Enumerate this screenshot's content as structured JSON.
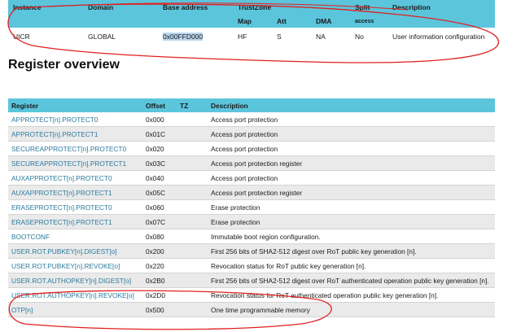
{
  "instance_table": {
    "headers": {
      "instance": "Instance",
      "domain": "Domain",
      "base_address": "Base address",
      "trustzone": "TrustZone",
      "split": "Split",
      "access": "access",
      "description": "Description",
      "map": "Map",
      "att": "Att",
      "dma": "DMA"
    },
    "row": {
      "instance": "UICR",
      "domain": "GLOBAL",
      "base_address": "0x00FFD000",
      "map": "HF",
      "att": "S",
      "dma": "NA",
      "split": "No",
      "description": "User information configuration"
    }
  },
  "section_title": "Register overview",
  "register_table": {
    "headers": {
      "register": "Register",
      "offset": "Offset",
      "tz": "TZ",
      "description": "Description"
    },
    "rows": [
      {
        "register": "APPROTECT[n].PROTECT0",
        "offset": "0x000",
        "tz": "",
        "description": "Access port protection"
      },
      {
        "register": "APPROTECT[n].PROTECT1",
        "offset": "0x01C",
        "tz": "",
        "description": "Access port protection"
      },
      {
        "register": "SECUREAPPROTECT[n].PROTECT0",
        "offset": "0x020",
        "tz": "",
        "description": "Access port protection"
      },
      {
        "register": "SECUREAPPROTECT[n].PROTECT1",
        "offset": "0x03C",
        "tz": "",
        "description": "Access port protection register"
      },
      {
        "register": "AUXAPPROTECT[n].PROTECT0",
        "offset": "0x040",
        "tz": "",
        "description": "Access port protection"
      },
      {
        "register": "AUXAPPROTECT[n].PROTECT1",
        "offset": "0x05C",
        "tz": "",
        "description": "Access port protection register"
      },
      {
        "register": "ERASEPROTECT[n].PROTECT0",
        "offset": "0x060",
        "tz": "",
        "description": "Erase protection"
      },
      {
        "register": "ERASEPROTECT[n].PROTECT1",
        "offset": "0x07C",
        "tz": "",
        "description": "Erase protection"
      },
      {
        "register": "BOOTCONF",
        "offset": "0x080",
        "tz": "",
        "description": "Immutable boot region configuration."
      },
      {
        "register": "USER.ROT.PUBKEY[n].DIGEST[o]",
        "offset": "0x200",
        "tz": "",
        "description": "First 256 bits of SHA2-512 digest over RoT public key generation [n]."
      },
      {
        "register": "USER.ROT.PUBKEY[n].REVOKE[o]",
        "offset": "0x220",
        "tz": "",
        "description": "Revocation status for RoT public key generation [n]."
      },
      {
        "register": "USER.ROT.AUTHOPKEY[n].DIGEST[o]",
        "offset": "0x2B0",
        "tz": "",
        "description": "First 256 bits of SHA2-512 digest over RoT authenticated operation public key generation [n]."
      },
      {
        "register": "USER.ROT.AUTHOPKEY[n].REVOKE[o]",
        "offset": "0x2D0",
        "tz": "",
        "description": "Revocation status for RoT authenticated operation public key generation [n]."
      },
      {
        "register": "OTP[n]",
        "offset": "0x500",
        "tz": "",
        "description": "One time programmable memory"
      }
    ]
  },
  "colors": {
    "header_bg": "#5bc5dc",
    "register_link": "#2b7a9e",
    "annotation_stroke": "#e02020",
    "selection_highlight": "#b9d5ec"
  }
}
